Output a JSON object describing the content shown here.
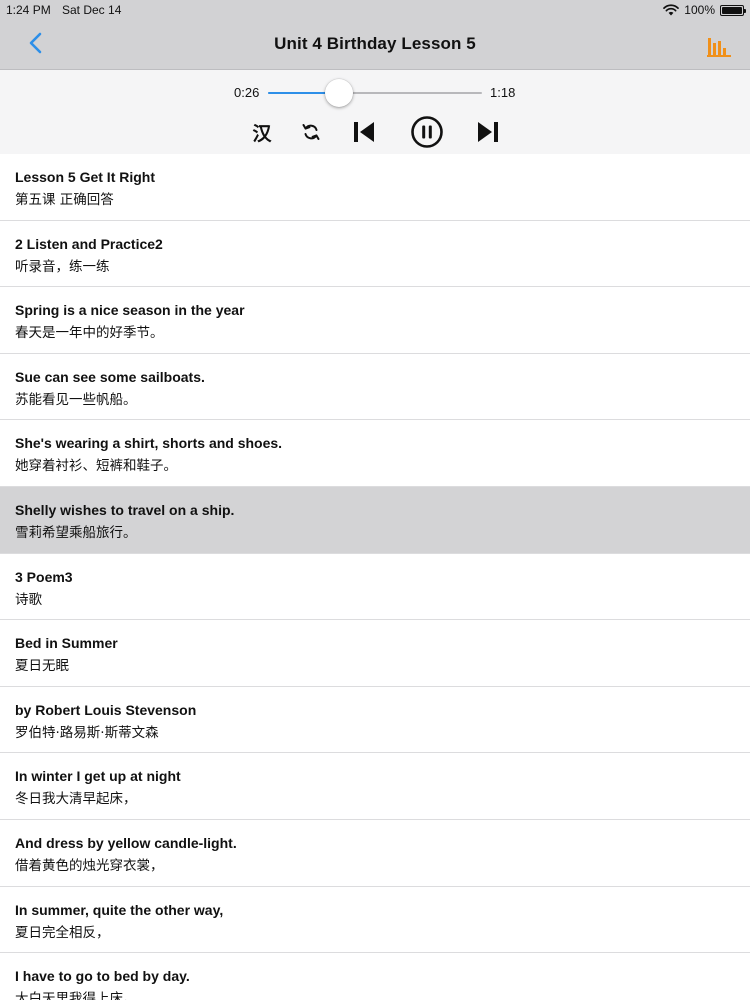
{
  "status": {
    "time": "1:24 PM",
    "date": "Sat Dec 14",
    "battery": "100%"
  },
  "nav": {
    "title": "Unit 4  Birthday Lesson 5"
  },
  "player": {
    "current": "0:26",
    "total": "1:18",
    "progress": 0.333,
    "han_label": "汉"
  },
  "colors": {
    "accent": "#2d8fe8",
    "chart_icon": "#f0901a",
    "active_row": "#d3d3d5"
  },
  "lessons": [
    {
      "en": "Lesson 5 Get It Right",
      "zh": "第五课 正确回答"
    },
    {
      "en": "2 Listen and Practice2",
      "zh": "听录音，练一练"
    },
    {
      "en": "Spring is a nice season in the year",
      "zh": "春天是一年中的好季节。"
    },
    {
      "en": "Sue can see some sailboats.",
      "zh": "苏能看见一些帆船。"
    },
    {
      "en": "She's wearing a shirt, shorts and shoes.",
      "zh": "她穿着衬衫、短裤和鞋子。"
    },
    {
      "en": "Shelly wishes to travel on a ship.",
      "zh": "雪莉希望乘船旅行。",
      "active": true
    },
    {
      "en": "3 Poem3",
      "zh": "诗歌"
    },
    {
      "en": "Bed in Summer",
      "zh": "夏日无眠"
    },
    {
      "en": "by Robert Louis Stevenson",
      "zh": "罗伯特·路易斯·斯蒂文森"
    },
    {
      "en": "In winter I get up at night",
      "zh": "冬日我大清早起床，"
    },
    {
      "en": "And dress by yellow candle-light.",
      "zh": "借着黄色的烛光穿衣裳，"
    },
    {
      "en": "In summer, quite the other way,",
      "zh": "夏日完全相反，"
    },
    {
      "en": "I have to go to bed by day.",
      "zh": "大白天里我得上床。"
    }
  ]
}
